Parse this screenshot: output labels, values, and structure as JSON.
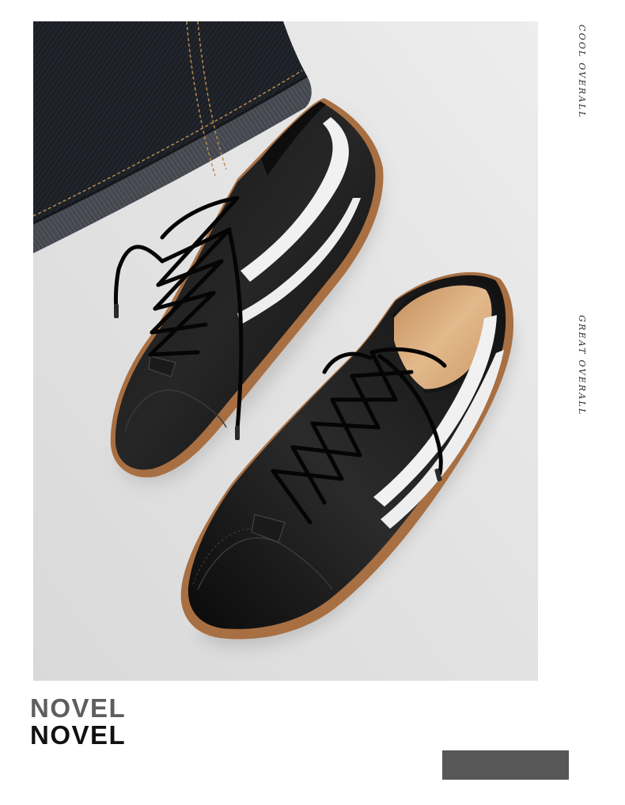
{
  "side_text": {
    "top": "COOL OVERALL",
    "middle": "GREAT OVERALL"
  },
  "title": {
    "line1": "NOVEL",
    "line2": "NOVEL"
  },
  "colors": {
    "background": "#ffffff",
    "photo_background": "#e3e3e3",
    "title_line1": "#5e5e5e",
    "title_line2": "#111111",
    "bar": "#575757",
    "leather": "#111111",
    "stripe": "#f1f1f1",
    "sole": "#a86f42",
    "insole": "#d6a576",
    "denim": "#1c1f25"
  }
}
